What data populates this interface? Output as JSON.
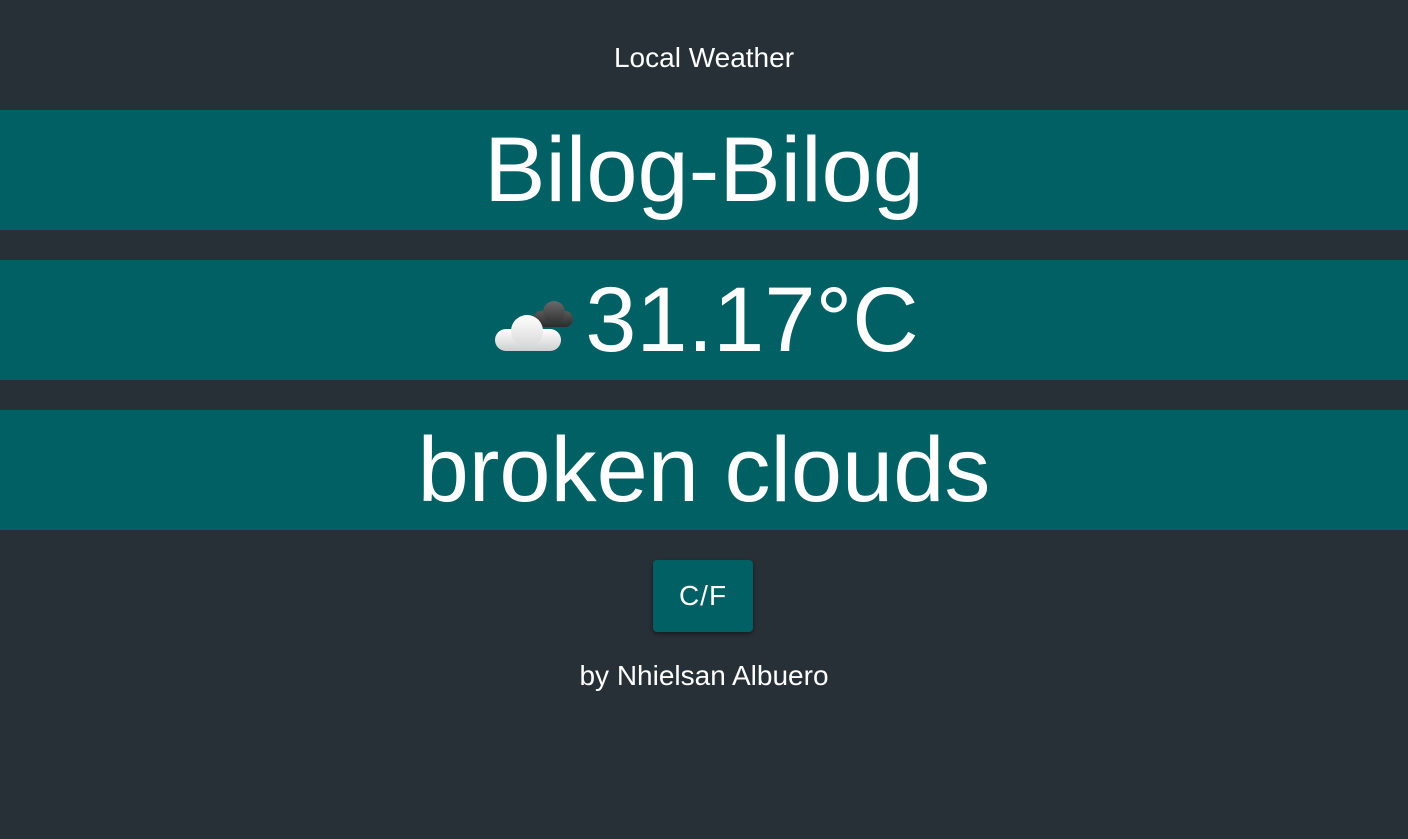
{
  "app": {
    "title": "Local Weather"
  },
  "weather": {
    "city": "Bilog-Bilog",
    "condition_icon": "broken-clouds-icon",
    "temperature": "31.17°C",
    "description": "broken clouds"
  },
  "controls": {
    "unit_toggle_label": "C/F"
  },
  "footer": {
    "credit": "by Nhielsan Albuero"
  },
  "colors": {
    "background": "#283037",
    "band": "#006064",
    "text": "#ffffff"
  }
}
